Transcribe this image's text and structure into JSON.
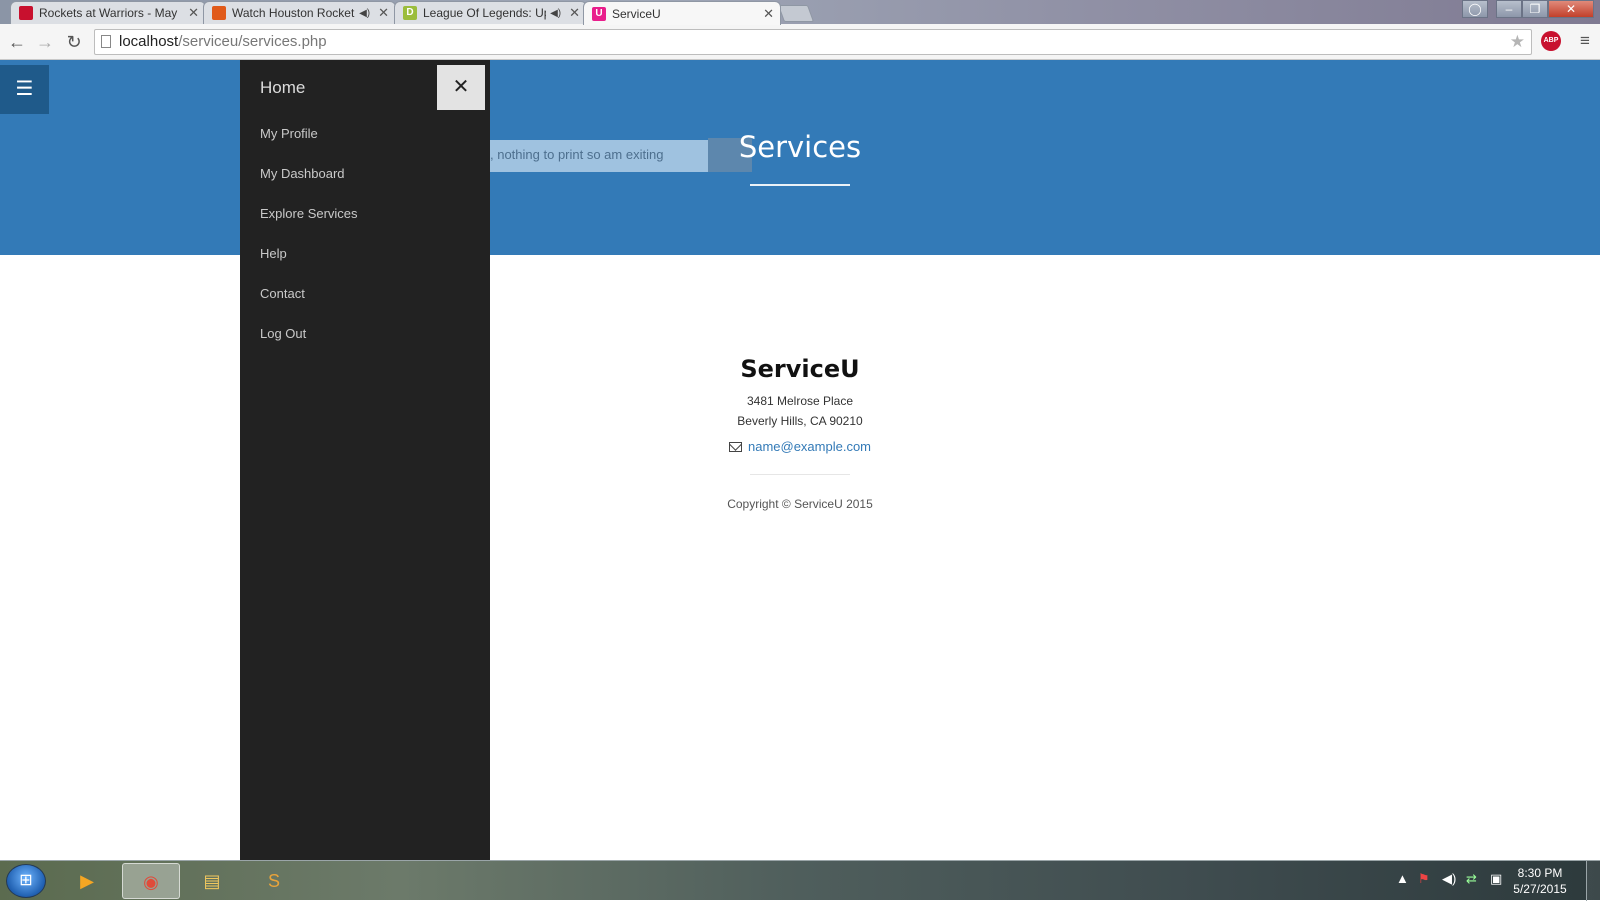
{
  "browser": {
    "tabs": [
      {
        "title": "Rockets at Warriors - May",
        "favicon_color": "#c8102e",
        "audio": false
      },
      {
        "title": "Watch Houston Rocket",
        "favicon_color": "#e05a1a",
        "audio": true
      },
      {
        "title": "League Of Legends: Up",
        "favicon_color": "#9bbd3c",
        "audio": true
      },
      {
        "title": "ServiceU",
        "favicon_color": "#e91e8c",
        "audio": false
      }
    ],
    "url_host": "localhost",
    "url_path": "/serviceu/services.php",
    "abp_label": "ABP"
  },
  "page": {
    "hero_title": "Services",
    "debug_message": ", nothing to print so am exiting",
    "sidebar": {
      "home": "Home",
      "items": [
        "My Profile",
        "My Dashboard",
        "Explore Services",
        "Help",
        "Contact",
        "Log Out"
      ]
    },
    "footer": {
      "company": "ServiceU",
      "address_line1": "3481 Melrose Place",
      "address_line2": "Beverly Hills, CA 90210",
      "email": "name@example.com",
      "copyright": "Copyright © ServiceU 2015"
    },
    "colors": {
      "hero": "#337ab7",
      "sidebar": "#222222",
      "link": "#337ab7"
    }
  },
  "taskbar": {
    "time": "8:30 PM",
    "date": "5/27/2015"
  }
}
